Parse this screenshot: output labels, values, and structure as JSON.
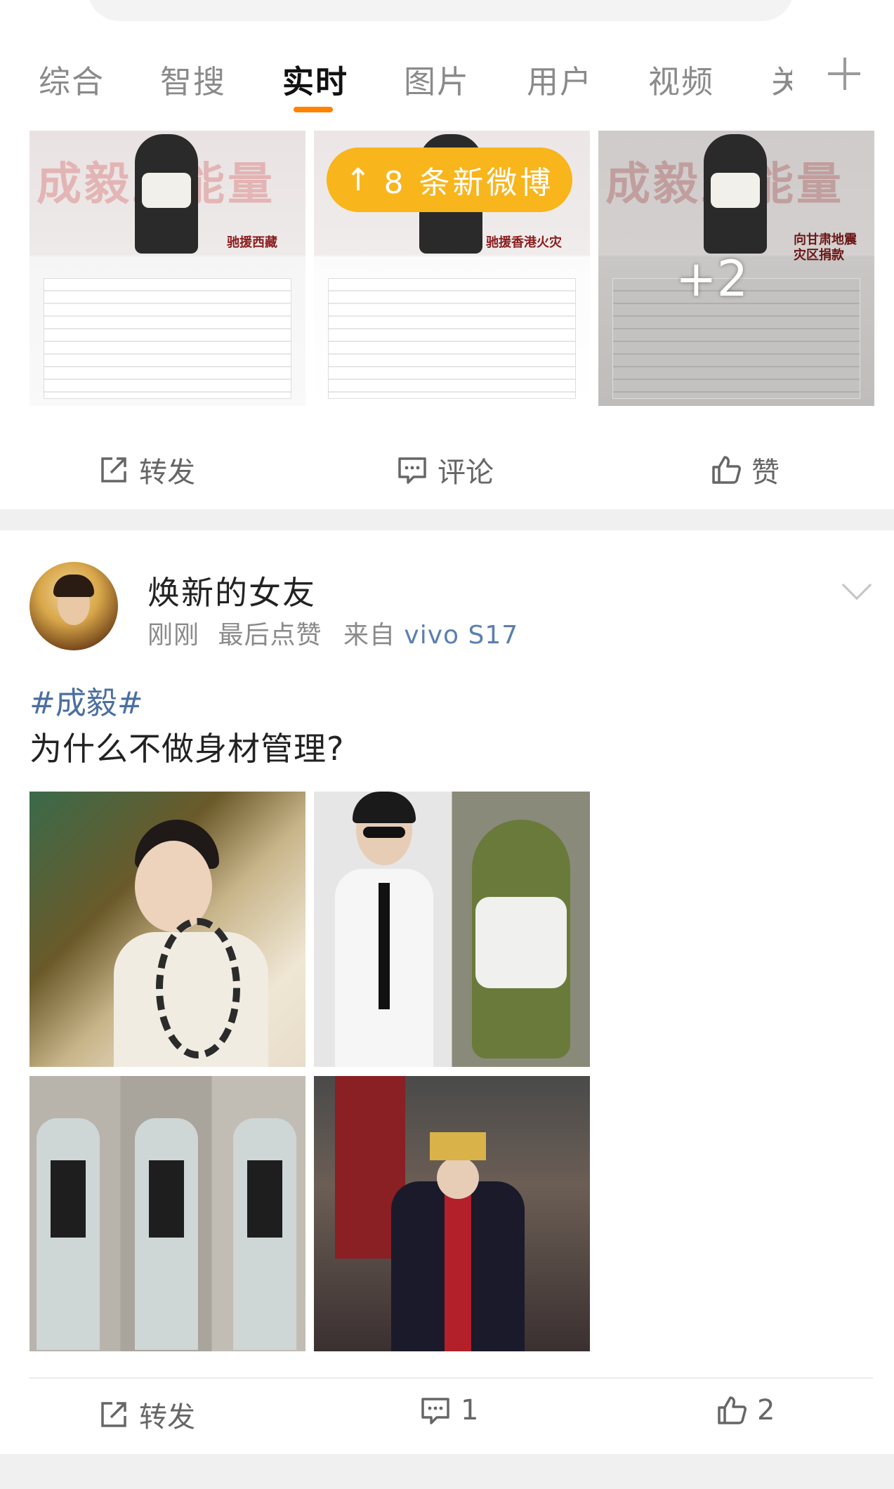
{
  "tabs": [
    "综合",
    "智搜",
    "实时",
    "图片",
    "用户",
    "视频",
    "关"
  ],
  "active_tab_index": 2,
  "new_weibo_pill": {
    "label": "8 条新微博",
    "arrow": "↑"
  },
  "post1": {
    "thumb_titles": [
      "成毅正能量",
      "",
      "成毅正能量"
    ],
    "thumb_subs": [
      "驰援西藏",
      "驰援香港火灾",
      "向甘肃地震灾区捐款"
    ],
    "more_images": "+2",
    "actions": {
      "repost": "转发",
      "comment": "评论",
      "like": "赞"
    }
  },
  "post2": {
    "username": "焕新的女友",
    "time": "刚刚",
    "last_like": "最后点赞",
    "source_prefix": "来自",
    "source": "vivo S17",
    "topic": "#成毅#",
    "text": "为什么不做身材管理?",
    "images": [
      "chain-costume-photo",
      "suit-vs-frog-photo",
      "three-outfits-photo",
      "emperor-costume-photo"
    ],
    "actions": {
      "repost": "转发",
      "comment_count": "1",
      "like_count": "2"
    }
  },
  "colors": {
    "accent": "#ff8200",
    "pill": "#f8b51c",
    "topic": "#4b6fa0"
  }
}
